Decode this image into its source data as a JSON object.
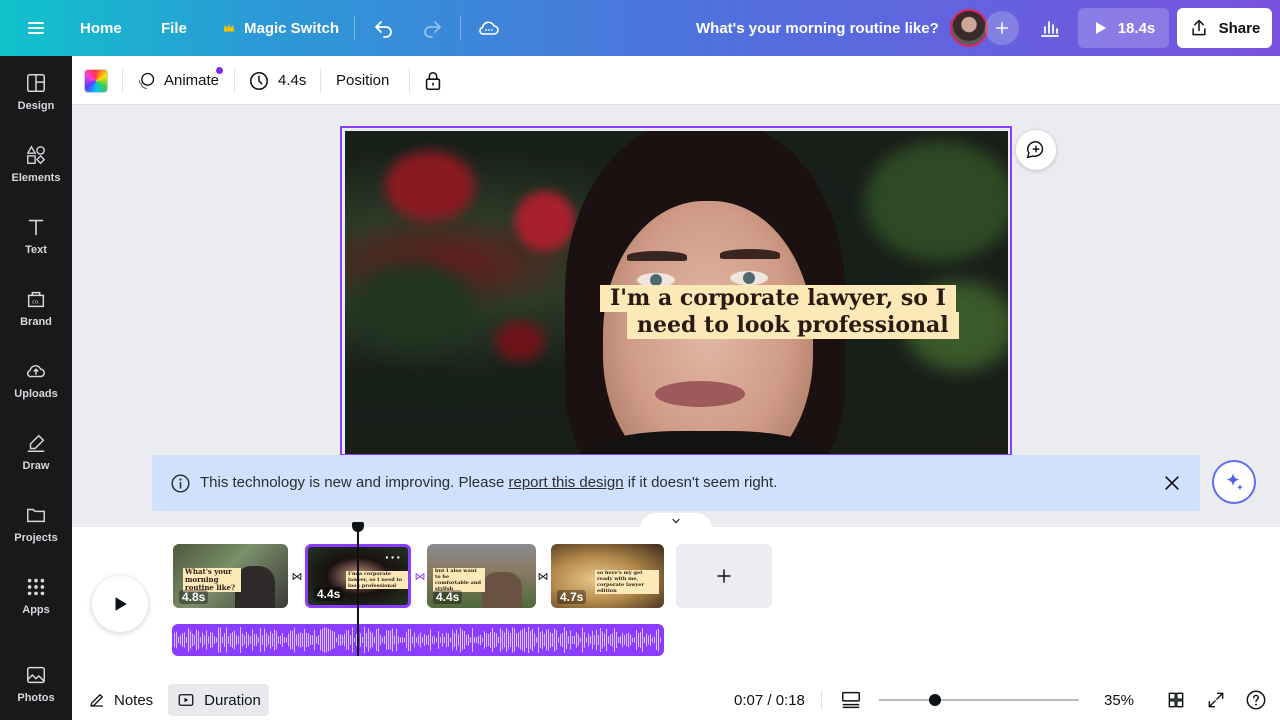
{
  "topbar": {
    "home": "Home",
    "file": "File",
    "magic_switch": "Magic Switch",
    "title": "What's your morning routine like?",
    "play_duration": "18.4s",
    "share": "Share"
  },
  "sidebar": {
    "items": [
      {
        "label": "Design",
        "icon": "design-icon"
      },
      {
        "label": "Elements",
        "icon": "elements-icon"
      },
      {
        "label": "Text",
        "icon": "text-icon"
      },
      {
        "label": "Brand",
        "icon": "brand-icon"
      },
      {
        "label": "Uploads",
        "icon": "uploads-icon"
      },
      {
        "label": "Draw",
        "icon": "draw-icon"
      },
      {
        "label": "Projects",
        "icon": "projects-icon"
      },
      {
        "label": "Apps",
        "icon": "apps-icon"
      },
      {
        "label": "Photos",
        "icon": "photos-icon"
      }
    ]
  },
  "toolbar": {
    "animate": "Animate",
    "duration": "4.4s",
    "position": "Position"
  },
  "canvas": {
    "caption_line1": "I'm a corporate lawyer, so I",
    "caption_line2": "need to look professional"
  },
  "banner": {
    "text_before": "This technology is new and improving. Please ",
    "link": "report this design",
    "text_after": " if it doesn't seem right."
  },
  "timeline": {
    "clips": [
      {
        "duration": "4.8s",
        "caption": "What's your morning routine like?"
      },
      {
        "duration": "4.4s",
        "caption": "I'm a corporate lawyer, so I need to look professional"
      },
      {
        "duration": "4.4s",
        "caption": "but I also want to be comfortable and stylish"
      },
      {
        "duration": "4.7s",
        "caption": "so here's my get ready with me, corporate lawyer edition"
      }
    ]
  },
  "bottombar": {
    "notes": "Notes",
    "duration": "Duration",
    "time": "0:07 / 0:18",
    "zoom": "35%",
    "zoom_level": 0.28
  },
  "colors": {
    "accent": "#8b3dff",
    "banner_bg": "#cfe1fc",
    "caption_bg": "#fde9b8"
  }
}
